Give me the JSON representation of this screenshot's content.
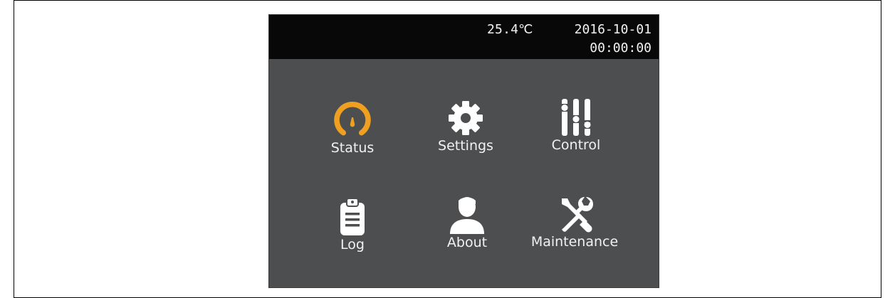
{
  "status_bar": {
    "temperature": "25.4℃",
    "date": "2016-10-01",
    "time": "00:00:00"
  },
  "menu": {
    "items": [
      {
        "label": "Status",
        "icon": "gauge-icon",
        "active": true
      },
      {
        "label": "Settings",
        "icon": "gear-icon",
        "active": false
      },
      {
        "label": "Control",
        "icon": "sliders-icon",
        "active": false
      },
      {
        "label": "Log",
        "icon": "clipboard-icon",
        "active": false
      },
      {
        "label": "About",
        "icon": "person-icon",
        "active": false
      },
      {
        "label": "Maintenance",
        "icon": "tools-icon",
        "active": false
      }
    ]
  },
  "colors": {
    "screen_background": "#4d4e50",
    "status_bar_background": "#080808",
    "active_accent": "#f0a020",
    "icon_default": "#ffffff",
    "label_text": "#f1f1f1"
  }
}
